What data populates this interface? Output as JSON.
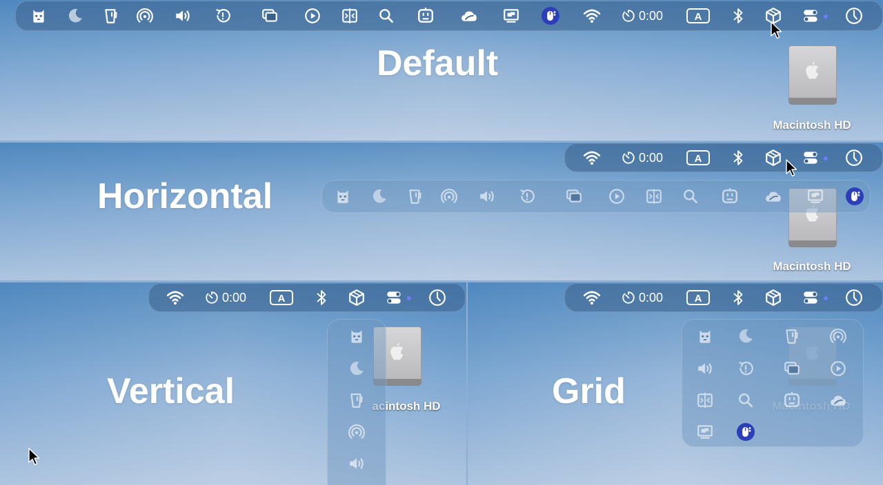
{
  "panels": {
    "default": {
      "title": "Default"
    },
    "horizontal": {
      "title": "Horizontal"
    },
    "vertical": {
      "title": "Vertical"
    },
    "grid": {
      "title": "Grid"
    }
  },
  "menubar": {
    "timer_value": "0:00",
    "input_source": "A"
  },
  "desktop": {
    "disk_label": "Macintosh HD",
    "disk_label_partial": "acintosh HD",
    "disk_label_faded": "Macintosh HD"
  },
  "icons": {
    "left_group": [
      "raccoon-icon",
      "moon-icon",
      "cup-icon",
      "airdrop-icon",
      "volume-icon",
      "warning-clock-icon",
      "windows-icon",
      "play-icon",
      "split-view-icon",
      "search-icon",
      "robot-icon",
      "cloud-icon",
      "display-icon",
      "mouse-icon"
    ],
    "right_group": [
      "wifi-icon",
      "timer-icon",
      "input-source-icon",
      "bluetooth-icon",
      "box-icon",
      "control-center-icon",
      "clock-icon"
    ]
  },
  "colors": {
    "menubar_bg": "#3a608c",
    "accent_dot": "#6b7cff",
    "mouse_app_bg": "#2c3fb8"
  }
}
